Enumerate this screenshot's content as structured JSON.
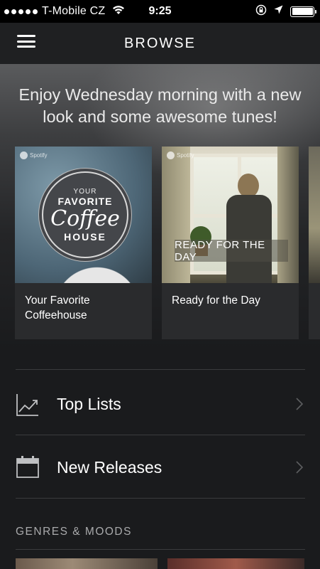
{
  "status_bar": {
    "carrier": "T-Mobile CZ",
    "time": "9:25",
    "battery_level": 1.0,
    "icons": [
      "signal-dots",
      "wifi-icon",
      "rotation-lock-icon",
      "location-arrow-icon",
      "battery-icon"
    ]
  },
  "nav": {
    "title": "BROWSE",
    "menu_icon": "hamburger-menu-icon"
  },
  "greeting": "Enjoy Wednesday morning with a new look and some awesome tunes!",
  "featured": [
    {
      "title": "Your Favorite Coffeehouse",
      "title_line1": "Your Favorite",
      "title_line2": "Coffeehouse",
      "image_text": {
        "line1": "YOUR",
        "line2": "FAVORITE",
        "line3": "Coffee",
        "line4": "HOUSE"
      },
      "brand": "Spotify"
    },
    {
      "title": "Ready for the Day",
      "image_text": "READY FOR THE DAY",
      "brand": "Spotify"
    }
  ],
  "lists": [
    {
      "label": "Top Lists",
      "icon": "chart-line-icon"
    },
    {
      "label": "New Releases",
      "icon": "calendar-icon"
    }
  ],
  "genres": {
    "heading": "GENRES & MOODS"
  },
  "colors": {
    "background": "#1a1b1d",
    "card": "#2a2b2d",
    "divider": "#3a3b3d",
    "secondary_text": "#a9aaac"
  }
}
